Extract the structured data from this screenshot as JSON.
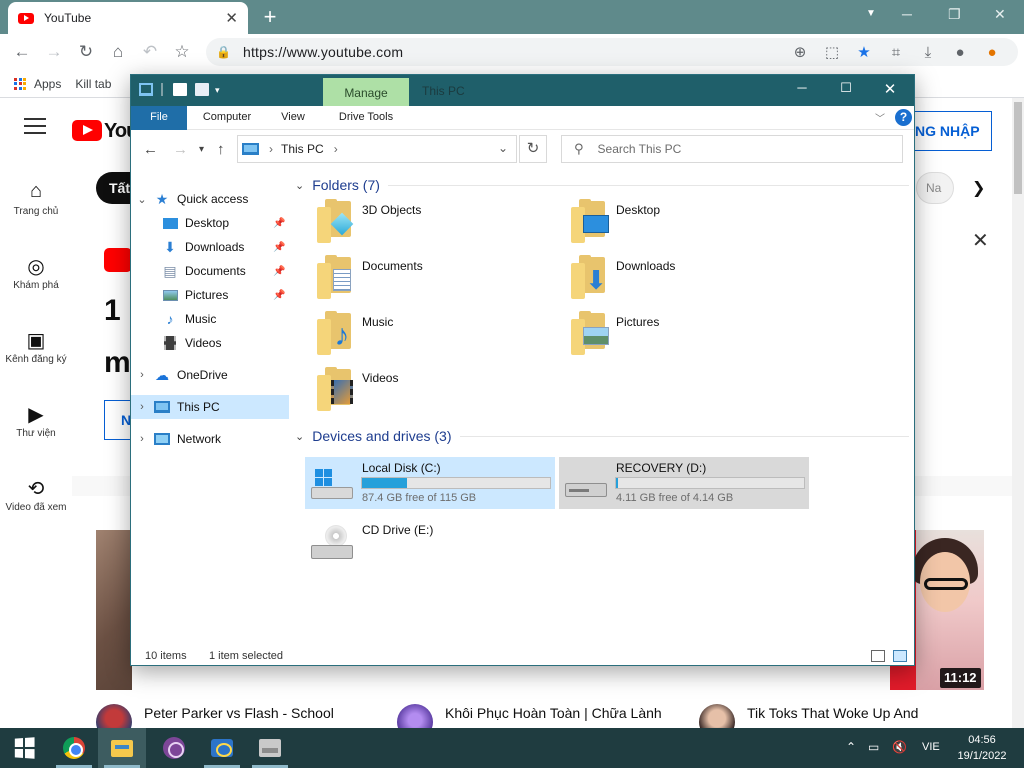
{
  "chrome": {
    "tab_title": "YouTube",
    "tab_close": "✕",
    "new_tab": "+",
    "url": "https://www.youtube.com",
    "bookmarks": [
      "Apps",
      "Kill tab"
    ]
  },
  "youtube": {
    "nav": [
      "Trang chủ",
      "Khám phá",
      "Kênh đăng ký",
      "Thư viện",
      "Video đã xem"
    ],
    "chip_all": "Tất",
    "signin": "NG NHẬP",
    "chip_next": "Na",
    "promo_line1": "1",
    "promo_line2": "m",
    "promo_btn": "N",
    "duration": "11:12",
    "videos": [
      "Peter Parker vs Flash - School",
      "Khôi Phục Hoàn Toàn | Chữa Lành",
      "Tik Toks That Woke Up And"
    ]
  },
  "explorer": {
    "window_title": "This PC",
    "manage_tab": "Manage",
    "ribbon_tabs": [
      "File",
      "Computer",
      "View",
      "Drive Tools"
    ],
    "address": "This PC",
    "search_placeholder": "Search This PC",
    "nav_pane": {
      "quick_access": "Quick access",
      "quick_items": [
        "Desktop",
        "Downloads",
        "Documents",
        "Pictures",
        "Music",
        "Videos"
      ],
      "onedrive": "OneDrive",
      "this_pc": "This PC",
      "network": "Network"
    },
    "folders_header": "Folders (7)",
    "folders": [
      "3D Objects",
      "Desktop",
      "Documents",
      "Downloads",
      "Music",
      "Pictures",
      "Videos"
    ],
    "drives_header": "Devices and drives (3)",
    "drives": [
      {
        "label": "Local Disk (C:)",
        "free": "87.4 GB free of 115 GB",
        "used_fraction": 0.24
      },
      {
        "label": "RECOVERY (D:)",
        "free": "4.11 GB free of 4.14 GB",
        "used_fraction": 0.01
      },
      {
        "label": "CD Drive (E:)"
      }
    ],
    "status_items": "10 items",
    "status_selected": "1 item selected"
  },
  "taskbar": {
    "language": "VIE",
    "time": "04:56",
    "date": "19/1/2022"
  },
  "colors": {
    "chrome_frame": "#5f8a8b",
    "explorer_title": "#1f5f6a",
    "manage_tab": "#aee0a6",
    "selection": "#cce8ff",
    "drive_fill": "#26a0da",
    "taskbar": "#1f3c40"
  }
}
